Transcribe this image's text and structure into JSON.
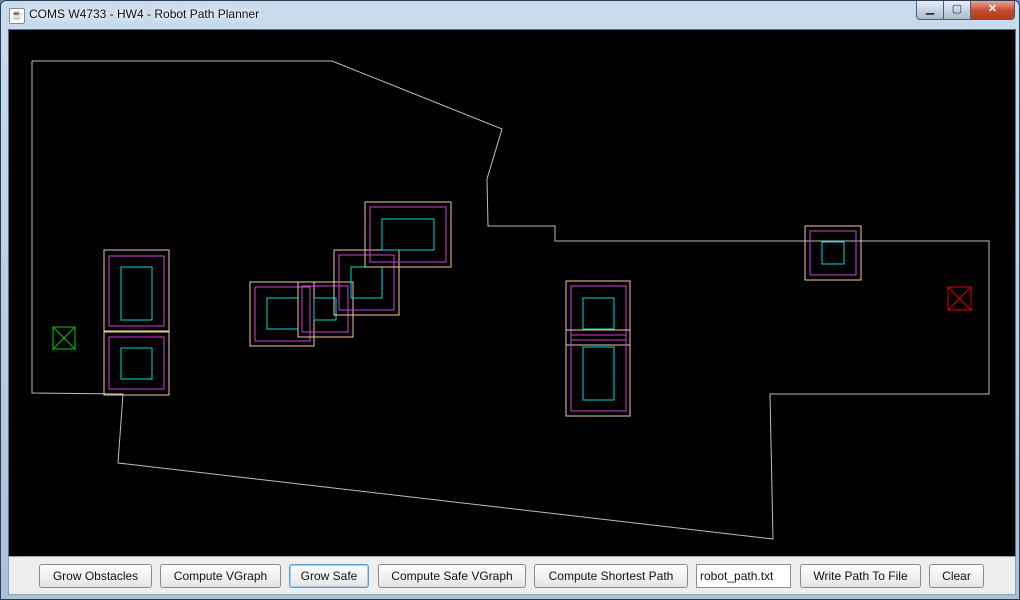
{
  "window": {
    "title": "COMS W4733 - HW4 - Robot Path Planner"
  },
  "window_controls": {
    "minimize": "▁",
    "maximize": "▢",
    "close": "✕"
  },
  "app_icon": {
    "glyph": "☕"
  },
  "colors": {
    "canvas_bg": "#000000",
    "boundary": "#bdbdbd",
    "obstacle": "#00d8d8",
    "grown": "#d040d0",
    "safe": "#f0c8a0",
    "start": "#00c800",
    "goal": "#e00000"
  },
  "toolbar": {
    "grow_obstacles": "Grow Obstacles",
    "compute_vgraph": "Compute VGraph",
    "grow_safe": "Grow Safe",
    "compute_safe_vgraph": "Compute Safe VGraph",
    "compute_shortest_path": "Compute Shortest Path",
    "output_filename": "robot_path.txt",
    "write_path": "Write Path To File",
    "clear": "Clear"
  }
}
